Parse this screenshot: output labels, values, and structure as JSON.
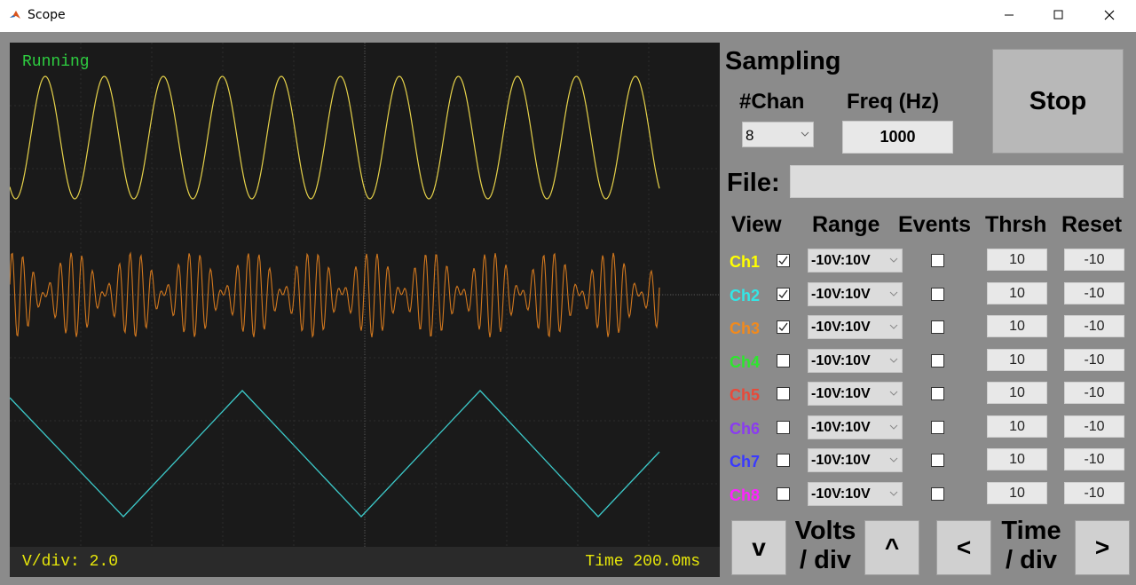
{
  "window": {
    "title": "Scope"
  },
  "scope": {
    "status": "Running",
    "vdiv_readout": "V/div: 2.0",
    "time_readout": "Time 200.0ms",
    "traces": [
      {
        "color": "#e6d24a",
        "shape": "sine"
      },
      {
        "color": "#d2781e",
        "shape": "beat"
      },
      {
        "color": "#3cc8c8",
        "shape": "triangle"
      }
    ]
  },
  "sampling": {
    "heading": "Sampling",
    "chan_label": "#Chan",
    "chan_value": "8",
    "freq_label": "Freq (Hz)",
    "freq_value": "1000",
    "stop_label": "Stop"
  },
  "file": {
    "label": "File:",
    "value": ""
  },
  "table": {
    "headers": {
      "view": "View",
      "range": "Range",
      "events": "Events",
      "thrsh": "Thrsh",
      "reset": "Reset"
    },
    "channels": [
      {
        "name": "Ch1",
        "color": "#ffff00",
        "view": true,
        "range": "-10V:10V",
        "events": false,
        "thrsh": "10",
        "reset": "-10"
      },
      {
        "name": "Ch2",
        "color": "#33e6e6",
        "view": true,
        "range": "-10V:10V",
        "events": false,
        "thrsh": "10",
        "reset": "-10"
      },
      {
        "name": "Ch3",
        "color": "#f08a1e",
        "view": true,
        "range": "-10V:10V",
        "events": false,
        "thrsh": "10",
        "reset": "-10"
      },
      {
        "name": "Ch4",
        "color": "#2ee62e",
        "view": false,
        "range": "-10V:10V",
        "events": false,
        "thrsh": "10",
        "reset": "-10"
      },
      {
        "name": "Ch5",
        "color": "#e84a3a",
        "view": false,
        "range": "-10V:10V",
        "events": false,
        "thrsh": "10",
        "reset": "-10"
      },
      {
        "name": "Ch6",
        "color": "#8a3cf0",
        "view": false,
        "range": "-10V:10V",
        "events": false,
        "thrsh": "10",
        "reset": "-10"
      },
      {
        "name": "Ch7",
        "color": "#3a3aff",
        "view": false,
        "range": "-10V:10V",
        "events": false,
        "thrsh": "10",
        "reset": "-10"
      },
      {
        "name": "Ch8",
        "color": "#ff22ff",
        "view": false,
        "range": "-10V:10V",
        "events": false,
        "thrsh": "10",
        "reset": "-10"
      }
    ]
  },
  "controls": {
    "volts_down": "v",
    "volts_label_1": "Volts",
    "volts_label_2": "/ div",
    "volts_up": "^",
    "time_left": "<",
    "time_label_1": "Time",
    "time_label_2": "/ div",
    "time_right": ">"
  }
}
